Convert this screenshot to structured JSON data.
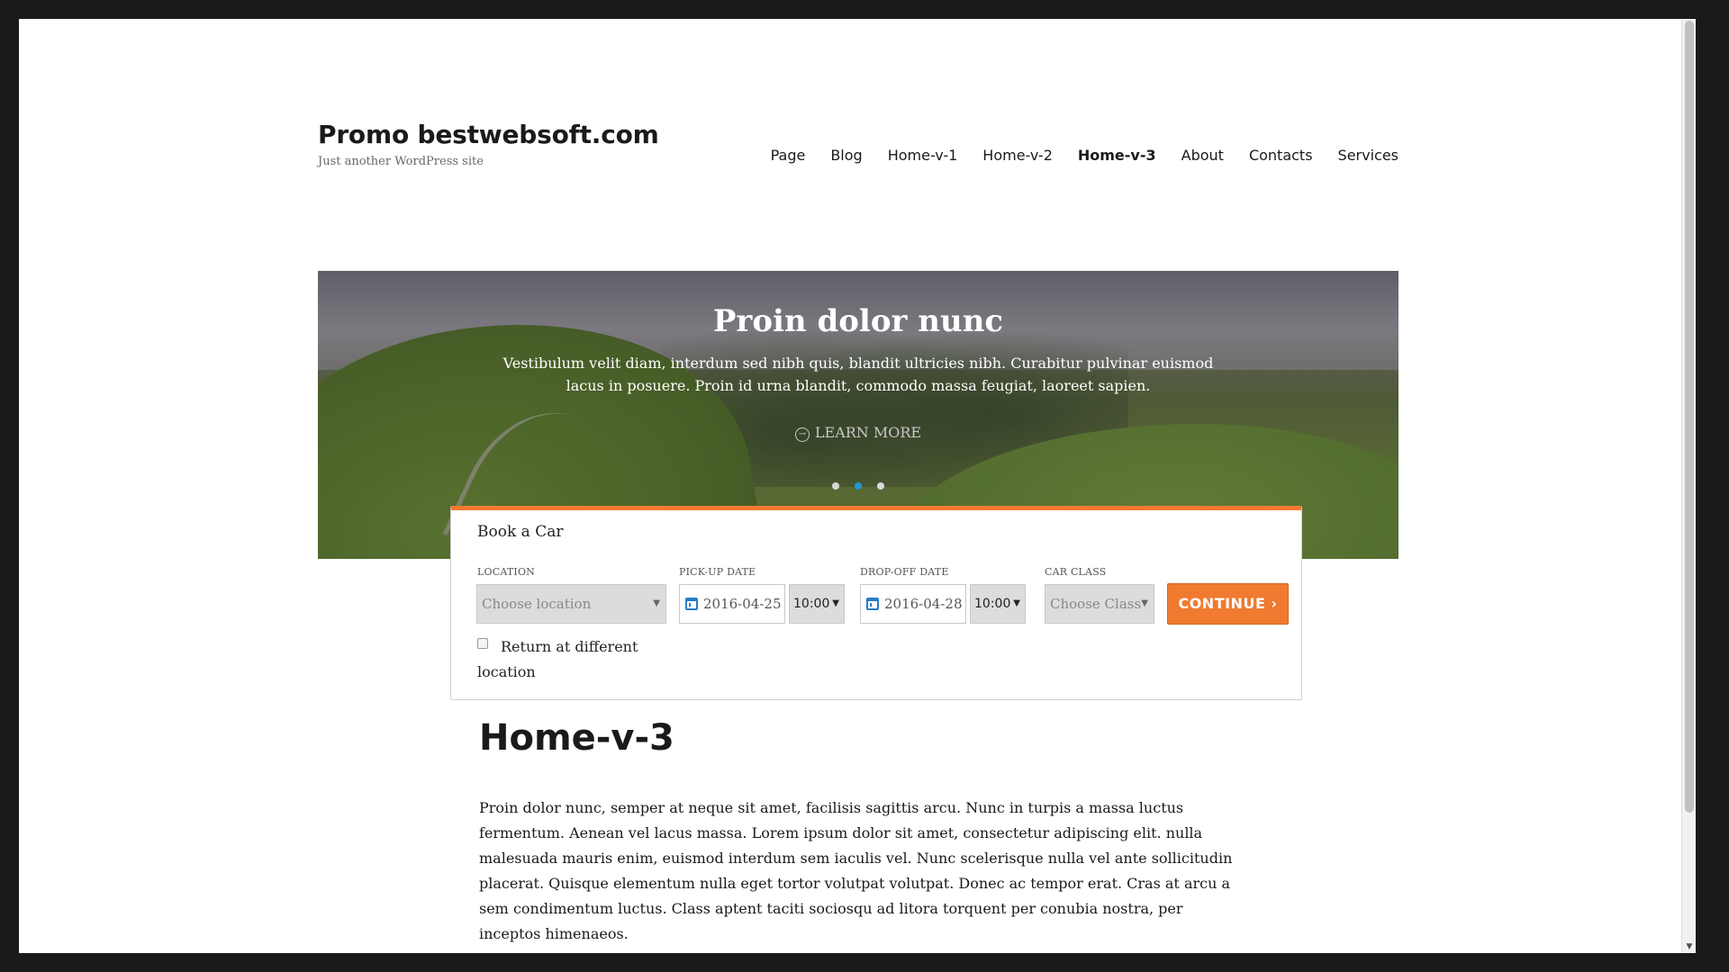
{
  "site": {
    "title": "Promo bestwebsoft.com",
    "description": "Just another WordPress site"
  },
  "nav": {
    "items": [
      {
        "label": "Page"
      },
      {
        "label": "Blog"
      },
      {
        "label": "Home-v-1"
      },
      {
        "label": "Home-v-2"
      },
      {
        "label": "Home-v-3",
        "active": true
      },
      {
        "label": "About"
      },
      {
        "label": "Contacts"
      },
      {
        "label": "Services"
      }
    ]
  },
  "slider": {
    "title": "Proin dolor nunc",
    "text": "Vestibulum velit diam, interdum sed nibh quis, blandit ultricies nibh. Curabitur pulvinar euismod lacus in posuere. Proin id urna blandit, commodo massa feugiat, laoreet sapien.",
    "learn_more": "LEARN MORE",
    "dots": 3,
    "active_dot": 2,
    "active_dot_color": "#2196d8"
  },
  "booking": {
    "title": "Book a Car",
    "location_label": "LOCATION",
    "location_placeholder": "Choose location",
    "pickup_label": "PICK-UP DATE",
    "pickup_date": "2016-04-25",
    "pickup_time": "10:00",
    "dropoff_label": "DROP-OFF DATE",
    "dropoff_date": "2016-04-28",
    "dropoff_time": "10:00",
    "class_label": "CAR CLASS",
    "class_placeholder": "Choose Class",
    "continue_label": "CONTINUE ›",
    "return_label": "Return at different location",
    "return_checked": false,
    "accent_color": "#f07a30"
  },
  "entry": {
    "title": "Home-v-3",
    "content": "Proin dolor nunc, semper at neque sit amet, facilisis sagittis arcu. Nunc in turpis a massa luctus fermentum. Aenean vel lacus massa. Lorem ipsum dolor sit amet, consectetur adipiscing elit. nulla malesuada mauris enim, euismod interdum sem iaculis vel. Nunc scelerisque nulla vel ante sollicitudin placerat. Quisque elementum nulla eget tortor volutpat volutpat. Donec ac tempor erat. Cras at arcu a sem condimentum luctus. Class aptent taciti sociosqu ad litora torquent per conubia nostra, per inceptos himenaeos."
  }
}
